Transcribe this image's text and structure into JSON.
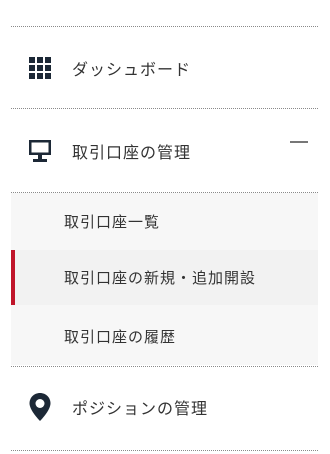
{
  "menu": {
    "dashboard": {
      "label": "ダッシュボード",
      "icon": "grid-icon"
    },
    "account": {
      "label": "取引口座の管理",
      "icon": "monitor-icon",
      "expanded": true,
      "subitems": [
        {
          "label": "取引口座一覧",
          "active": false
        },
        {
          "label": "取引口座の新規・追加開設",
          "active": true
        },
        {
          "label": "取引口座の履歴",
          "active": false
        }
      ]
    },
    "positions": {
      "label": "ポジションの管理",
      "icon": "map-pin-icon"
    }
  },
  "colors": {
    "icon": "#1c2836",
    "accent": "#c0152a",
    "active_bg": "#f2f2f2",
    "sub_bg": "#f7f7f7"
  }
}
